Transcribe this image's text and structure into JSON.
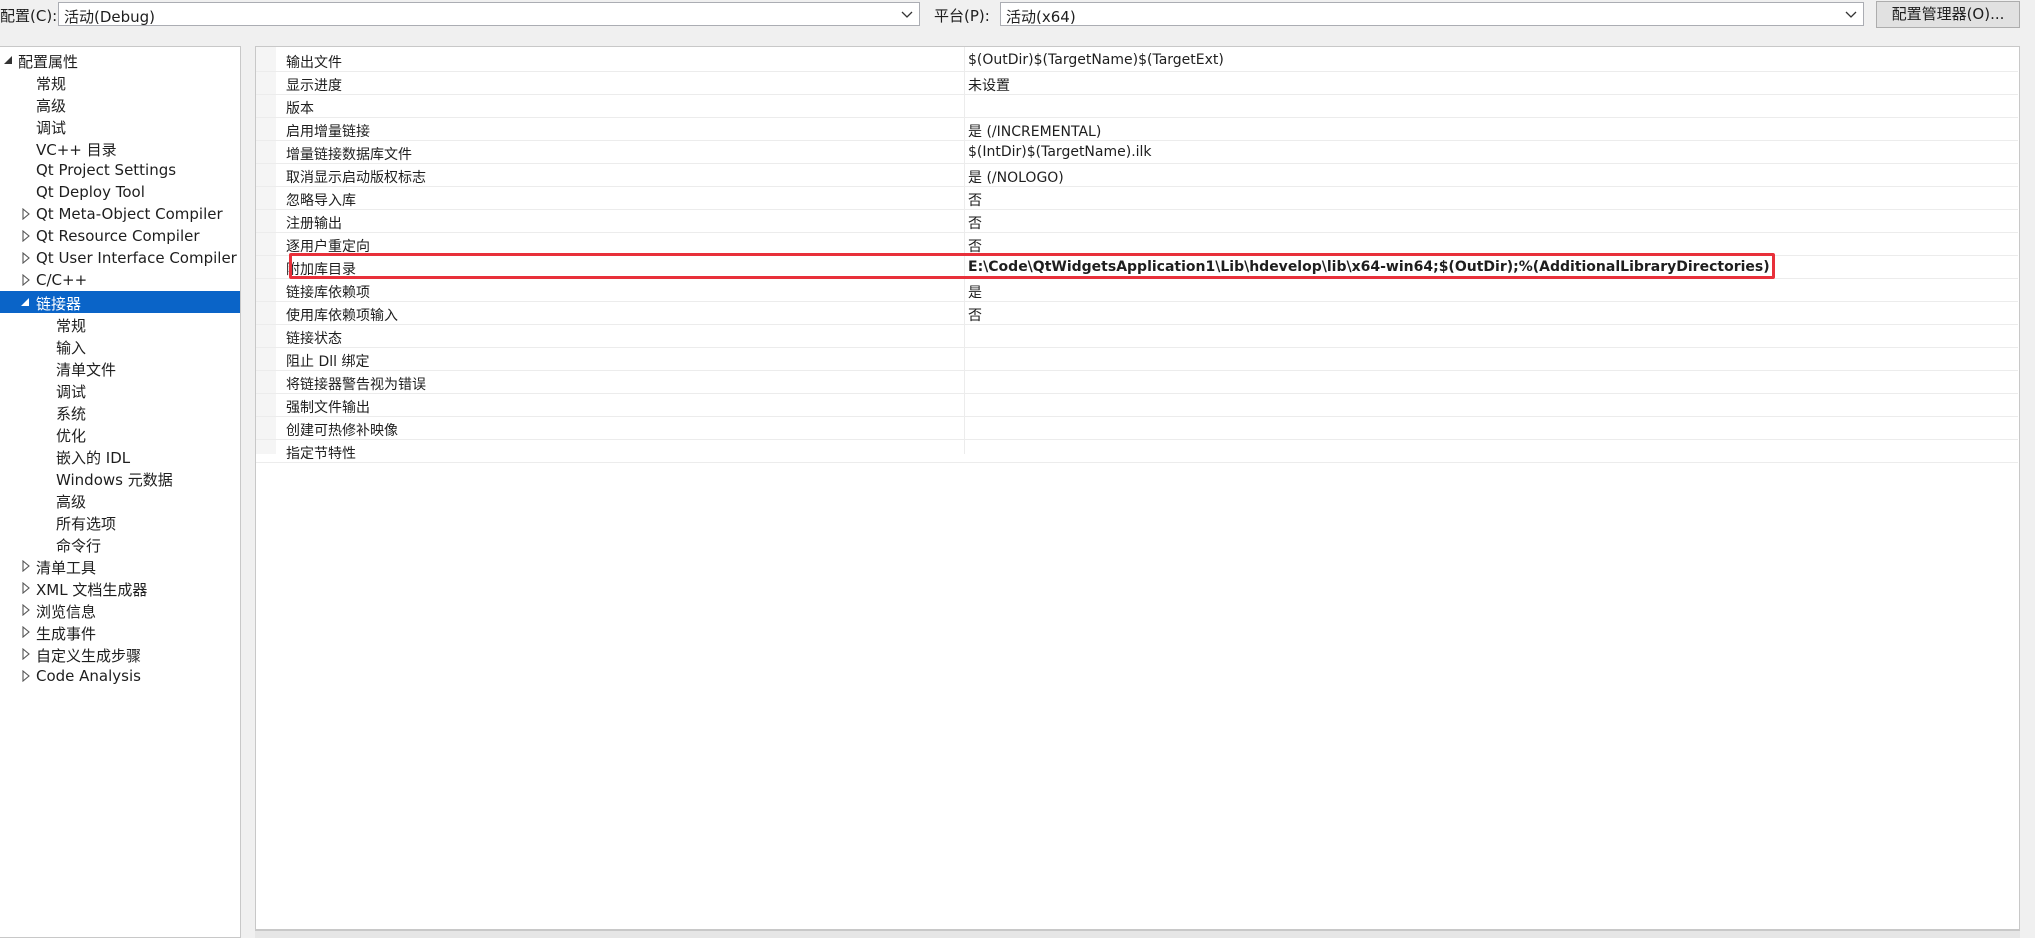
{
  "toolbar": {
    "config_label": "配置(C):",
    "config_value": "活动(Debug)",
    "platform_label": "平台(P):",
    "platform_value": "活动(x64)",
    "config_manager_button": "配置管理器(O)..."
  },
  "tree": {
    "root": "配置属性",
    "items": [
      {
        "label": "常规"
      },
      {
        "label": "高级"
      },
      {
        "label": "调试"
      },
      {
        "label": "VC++ 目录"
      },
      {
        "label": "Qt Project Settings"
      },
      {
        "label": "Qt Deploy Tool"
      },
      {
        "label": "Qt Meta-Object Compiler"
      },
      {
        "label": "Qt Resource Compiler"
      },
      {
        "label": "Qt User Interface Compiler"
      },
      {
        "label": "C/C++"
      },
      {
        "label": "链接器"
      },
      {
        "label": "常规"
      },
      {
        "label": "输入"
      },
      {
        "label": "清单文件"
      },
      {
        "label": "调试"
      },
      {
        "label": "系统"
      },
      {
        "label": "优化"
      },
      {
        "label": "嵌入的 IDL"
      },
      {
        "label": "Windows 元数据"
      },
      {
        "label": "高级"
      },
      {
        "label": "所有选项"
      },
      {
        "label": "命令行"
      },
      {
        "label": "清单工具"
      },
      {
        "label": "XML 文档生成器"
      },
      {
        "label": "浏览信息"
      },
      {
        "label": "生成事件"
      },
      {
        "label": "自定义生成步骤"
      },
      {
        "label": "Code Analysis"
      }
    ]
  },
  "properties": [
    {
      "name": "输出文件",
      "value": "$(OutDir)$(TargetName)$(TargetExt)"
    },
    {
      "name": "显示进度",
      "value": "未设置"
    },
    {
      "name": "版本",
      "value": ""
    },
    {
      "name": "启用增量链接",
      "value": "是 (/INCREMENTAL)"
    },
    {
      "name": "增量链接数据库文件",
      "value": "$(IntDir)$(TargetName).ilk"
    },
    {
      "name": "取消显示启动版权标志",
      "value": "是 (/NOLOGO)"
    },
    {
      "name": "忽略导入库",
      "value": "否"
    },
    {
      "name": "注册输出",
      "value": "否"
    },
    {
      "name": "逐用户重定向",
      "value": "否"
    },
    {
      "name": "附加库目录",
      "value": "E:\\Code\\QtWidgetsApplication1\\Lib\\hdevelop\\lib\\x64-win64;$(OutDir);%(AdditionalLibraryDirectories)"
    },
    {
      "name": "链接库依赖项",
      "value": "是"
    },
    {
      "name": "使用库依赖项输入",
      "value": "否"
    },
    {
      "name": "链接状态",
      "value": ""
    },
    {
      "name": "阻止 Dll 绑定",
      "value": ""
    },
    {
      "name": "将链接器警告视为错误",
      "value": ""
    },
    {
      "name": "强制文件输出",
      "value": ""
    },
    {
      "name": "创建可热修补映像",
      "value": ""
    },
    {
      "name": "指定节特性",
      "value": ""
    }
  ],
  "colors": {
    "selection": "#0a64c8",
    "highlight_border": "#e8303a"
  }
}
